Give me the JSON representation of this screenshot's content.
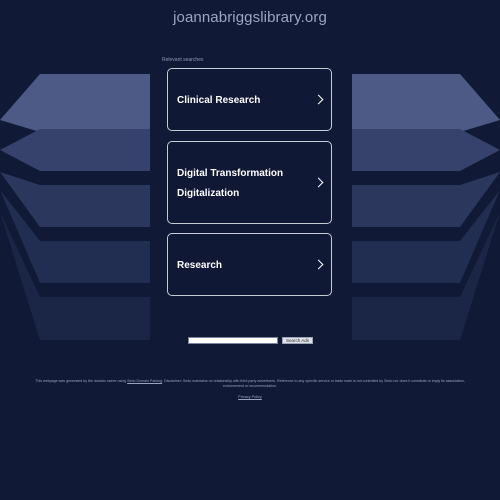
{
  "site": {
    "domain": "joannabriggslibrary.org"
  },
  "related": {
    "label": "Relevant searches",
    "items": [
      {
        "label": "Clinical Research"
      },
      {
        "label": "Digital Transformation"
      },
      {
        "label": "Digitalization"
      },
      {
        "label": "Research"
      }
    ]
  },
  "search": {
    "input_value": "",
    "button_label": "Search Ads"
  },
  "footer": {
    "disclaimer_before": "This webpage was generated by the domain owner using",
    "disclaimer_link": "Sedo Domain Parking",
    "disclaimer_after": ". Disclaimer: Sedo maintains no relationship with third party advertisers. Reference to any specific service or trade mark is not controlled by Sedo nor does it constitute or imply its association, endorsement or recommendation.",
    "privacy_label": "Privacy Policy"
  },
  "colors": {
    "background": "#101935",
    "card_border": "#c7cbd6",
    "text": "#ffffff",
    "muted_text": "#9aa6c4"
  }
}
